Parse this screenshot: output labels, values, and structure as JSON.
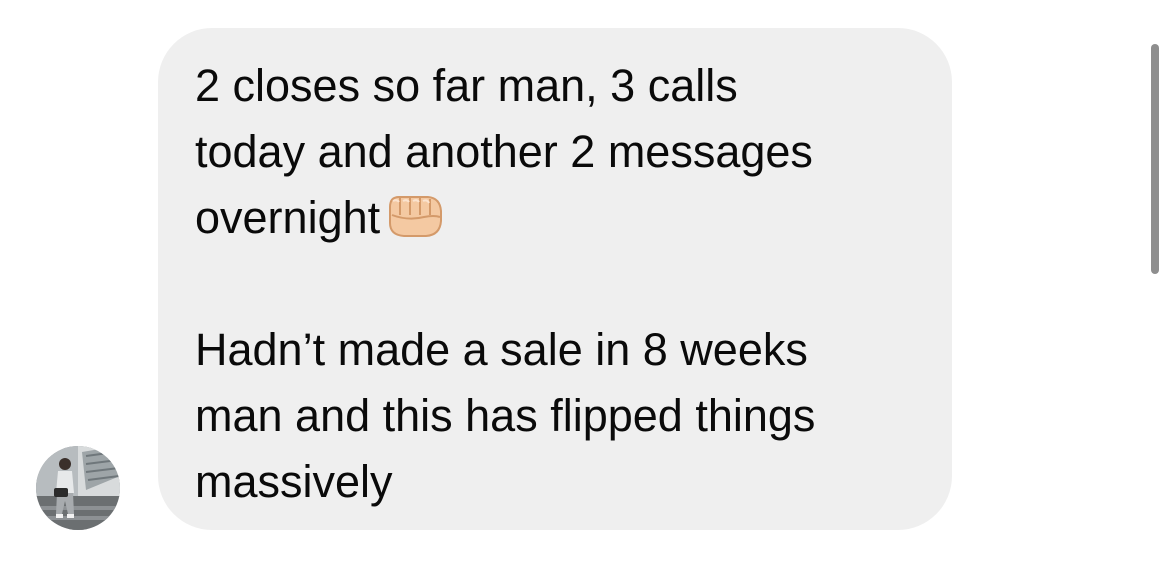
{
  "message": {
    "lines": [
      "2 closes so far man, 3 calls",
      "today and another 2 messages",
      "overnight",
      "",
      "Hadn’t made a sale in 8 weeks",
      "man and this has flipped things",
      "massively"
    ],
    "emoji": "fist-bump-emoji"
  },
  "colors": {
    "bubble_bg": "#efefef",
    "text": "#0a0a0a",
    "page_bg": "#ffffff",
    "scrollbar": "#8e8e8e"
  },
  "icons": {
    "avatar": "profile-photo",
    "emoji": "oncoming-fist-icon"
  }
}
